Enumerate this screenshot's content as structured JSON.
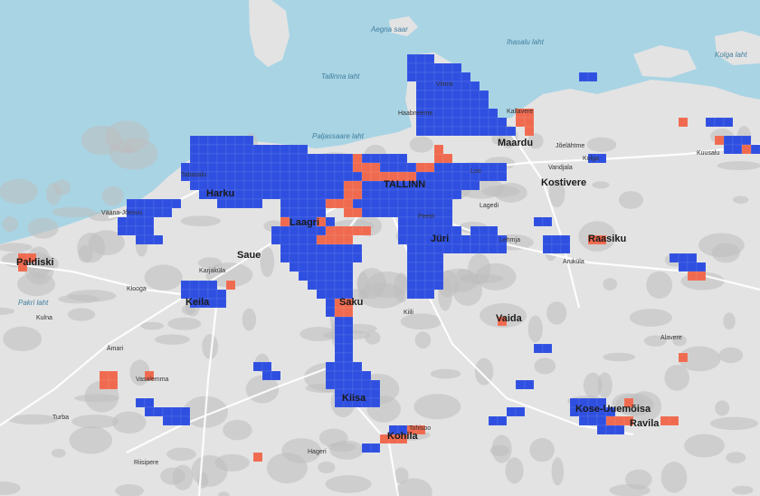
{
  "colors": {
    "sea": "#a9d4e4",
    "land": "#e9e9e9",
    "land_dark": "#bdbdbd",
    "road": "#ffffff",
    "high_cluster": "#2f4fe0",
    "low_cluster": "#ef6a4f"
  },
  "labels": {
    "water": {
      "tallinna_laht": "Tallinna laht",
      "aegna_saar": "Aegna saar",
      "ihasalu_laht": "Ihasalu laht",
      "kolga_laht": "Kolga laht",
      "paljassaare_laht": "Paljassaare laht",
      "pakri_laht": "Pakri laht"
    },
    "cities": {
      "tallinn": "TALLINN",
      "maardu": "Maardu",
      "keila": "Keila",
      "saku": "Saku",
      "kiisa": "Kiisa",
      "kohila": "Kohila",
      "saue": "Saue",
      "paldiski": "Paldiski",
      "kostivere": "Kostivere",
      "raasiku": "Raasiku",
      "kose_uuemoisa": "Kose-Uuemõisa",
      "ravila": "Ravila",
      "jüri": "Jüri",
      "laagri": "Laagri",
      "harku": "Harku",
      "vaida": "Vaida"
    },
    "towns": {
      "viimsi": "Viimsi",
      "haabneeme": "Haabneeme",
      "loo": "Loo",
      "kallavere": "Kallavere",
      "lagedi": "Lagedi",
      "peetri": "Peetri",
      "tabasalu": "Tabasalu",
      "vaanatoo": "Vääna-Jõesuu",
      "karjakula": "Karjaküla",
      "kulna": "Kulna",
      "vasalemma": "Vasalemma",
      "riisipere": "Riisipere",
      "hageri": "Hageri",
      "aruküla": "Aruküla",
      "kuusalu": "Kuusalu",
      "kiili": "Kiili",
      "turba": "Turba",
      "klooga": "Klooga",
      "ämari": "Ämari",
      "alavere": "Alavere",
      "kolga": "Kolga",
      "vandjala": "Vandjala",
      "jõelähtme": "Jõelähtme",
      "lehmja": "Lehmja",
      "tohisoo": "Tohisoo"
    }
  }
}
